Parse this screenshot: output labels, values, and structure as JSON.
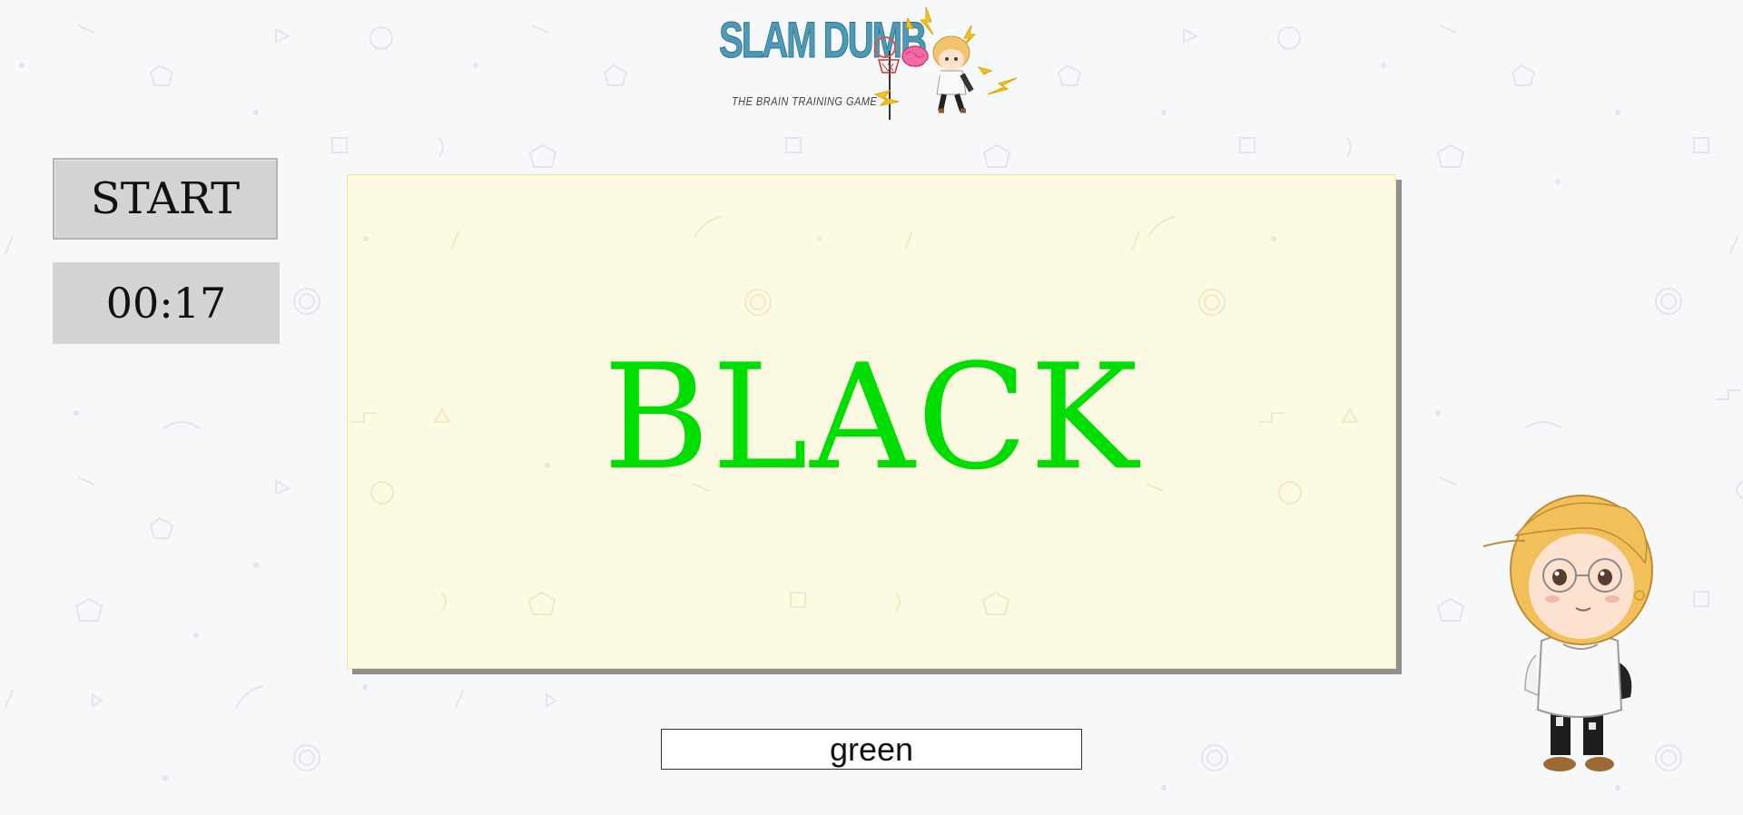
{
  "logo": {
    "title": "SLAM DUMB",
    "subtitle": "THE BRAIN TRAINING GAME"
  },
  "controls": {
    "start_label": "START",
    "timer_value": "00:17"
  },
  "card": {
    "word": "BLACK",
    "word_color": "#00dd00"
  },
  "answer": {
    "value": "green"
  },
  "colors": {
    "page_background": "#f7f8fa",
    "card_background": "#fcfae2",
    "button_background": "#d4d4d4",
    "logo_blue": "#4c9ab7"
  },
  "icons": [
    "basketball-hoop-icon",
    "lightning-bolt-icon",
    "brain-icon",
    "mascot-character-image"
  ]
}
